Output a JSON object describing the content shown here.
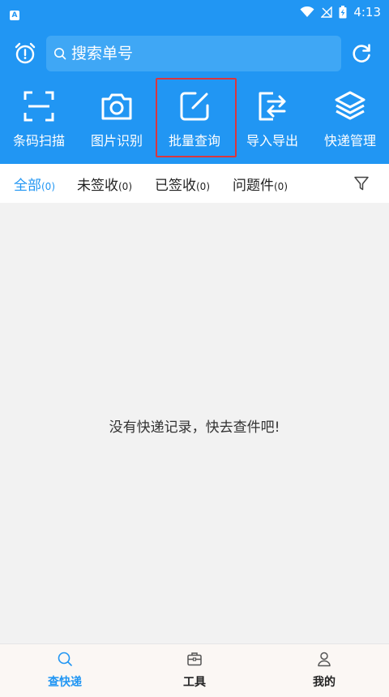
{
  "status_bar": {
    "app_badge": "A",
    "time": "4:13",
    "icons": [
      "wifi-icon",
      "no-signal-icon",
      "battery-charging-icon"
    ]
  },
  "header": {
    "search": {
      "placeholder": "搜索单号",
      "value": ""
    },
    "left_icon": "alarm-clock-icon",
    "right_icon": "refresh-icon"
  },
  "tools": [
    {
      "label": "条码扫描",
      "icon": "barcode-scan-icon"
    },
    {
      "label": "图片识别",
      "icon": "camera-icon"
    },
    {
      "label": "批量查询",
      "icon": "edit-icon",
      "highlighted": true
    },
    {
      "label": "导入导出",
      "icon": "import-export-icon"
    },
    {
      "label": "快递管理",
      "icon": "layers-icon"
    }
  ],
  "filter_tabs": [
    {
      "label": "全部",
      "count": "(0)",
      "active": true
    },
    {
      "label": "未签收",
      "count": "(0)"
    },
    {
      "label": "已签收",
      "count": "(0)"
    },
    {
      "label": "问题件",
      "count": "(0)"
    }
  ],
  "empty_message": "没有快递记录，快去查件吧!",
  "bottom_nav": [
    {
      "label": "查快递",
      "icon": "search-icon",
      "active": true
    },
    {
      "label": "工具",
      "icon": "toolbox-icon"
    },
    {
      "label": "我的",
      "icon": "user-icon"
    }
  ],
  "colors": {
    "primary": "#2196f3",
    "highlight_border": "#d9363e",
    "background": "#f2f2f2"
  }
}
